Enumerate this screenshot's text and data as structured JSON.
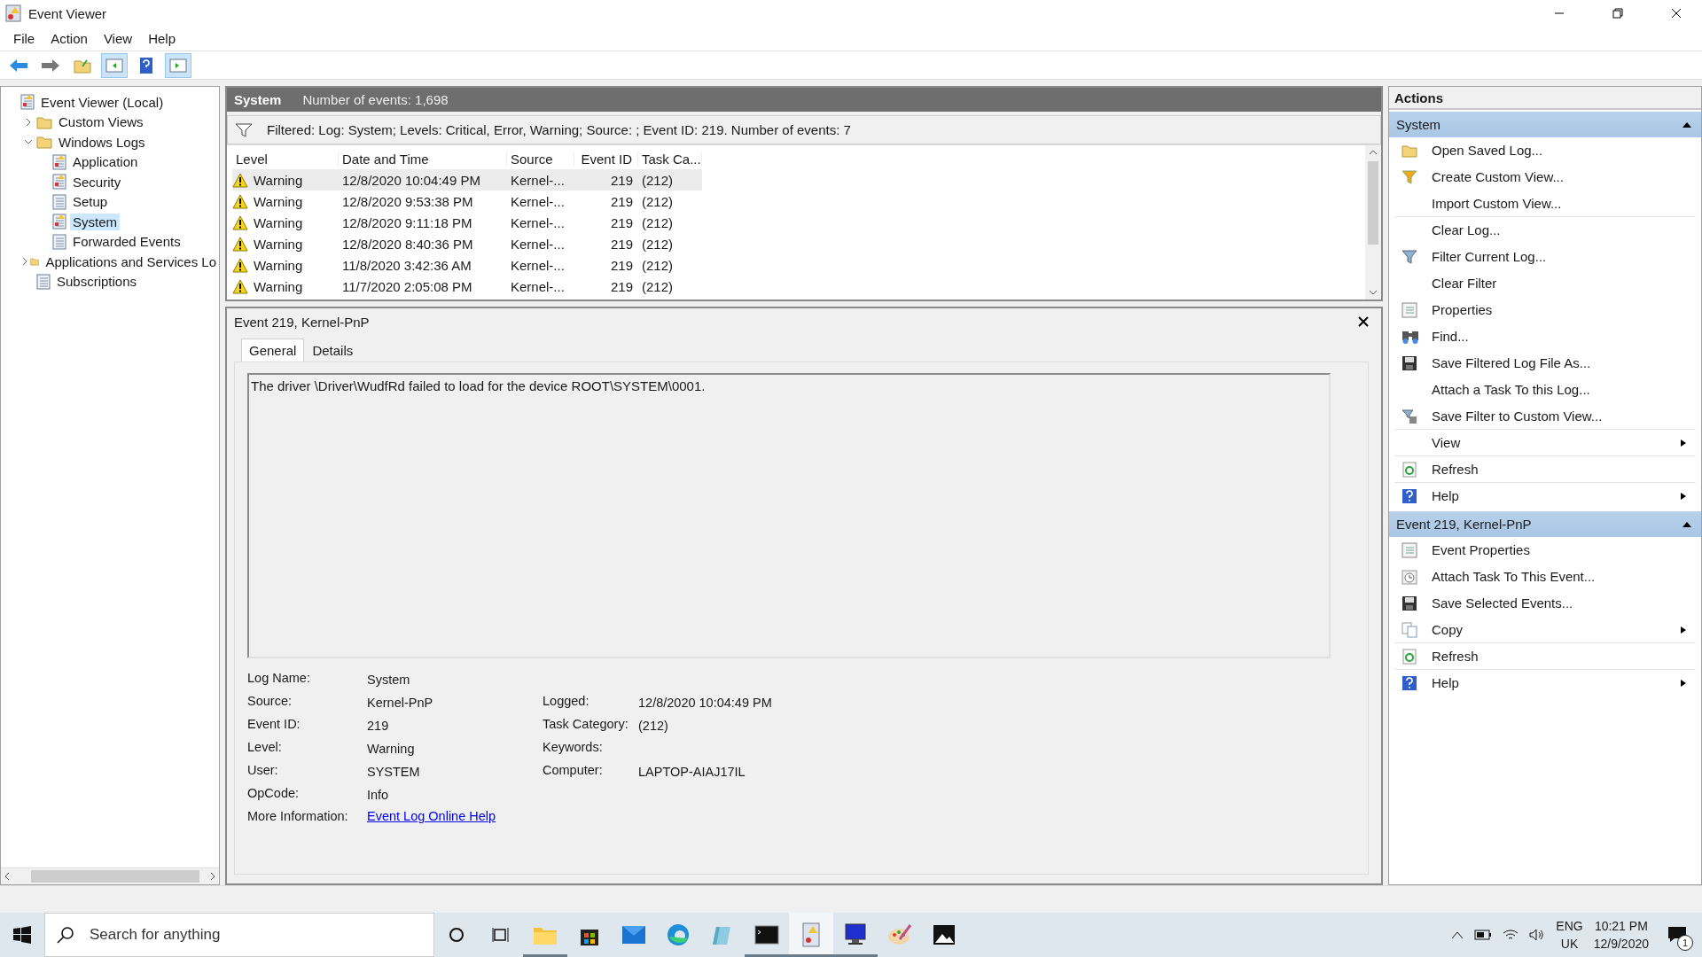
{
  "window": {
    "title": "Event Viewer"
  },
  "menu": [
    "File",
    "Action",
    "View",
    "Help"
  ],
  "tree": [
    {
      "label": "Event Viewer (Local)",
      "selected": false,
      "children": [
        {
          "label": "Custom Views",
          "expanded": false,
          "selected": false
        },
        {
          "label": "Windows Logs",
          "expanded": true,
          "selected": false,
          "children": [
            {
              "label": "Application",
              "selected": false
            },
            {
              "label": "Security",
              "selected": false
            },
            {
              "label": "Setup",
              "selected": false
            },
            {
              "label": "System",
              "selected": true
            },
            {
              "label": "Forwarded Events",
              "selected": false
            }
          ]
        },
        {
          "label": "Applications and Services Lo",
          "expanded": false,
          "selected": false
        },
        {
          "label": "Subscriptions",
          "selected": false
        }
      ]
    }
  ],
  "log_header": {
    "name": "System",
    "count": "Number of events: 1,698"
  },
  "filter": "Filtered: Log: System; Levels: Critical, Error, Warning; Source: ; Event ID: 219. Number of events: 7",
  "table": {
    "columns": [
      "Level",
      "Date and Time",
      "Source",
      "Event ID",
      "Task Ca..."
    ],
    "rows": [
      {
        "level": "Warning",
        "date": "12/8/2020 10:04:49 PM",
        "source": "Kernel-...",
        "event_id": "219",
        "task_category": "(212)",
        "selected": true
      },
      {
        "level": "Warning",
        "date": "12/8/2020 9:53:38 PM",
        "source": "Kernel-...",
        "event_id": "219",
        "task_category": "(212)",
        "selected": false
      },
      {
        "level": "Warning",
        "date": "12/8/2020 9:11:18 PM",
        "source": "Kernel-...",
        "event_id": "219",
        "task_category": "(212)",
        "selected": false
      },
      {
        "level": "Warning",
        "date": "12/8/2020 8:40:36 PM",
        "source": "Kernel-...",
        "event_id": "219",
        "task_category": "(212)",
        "selected": false
      },
      {
        "level": "Warning",
        "date": "11/8/2020 3:42:36 AM",
        "source": "Kernel-...",
        "event_id": "219",
        "task_category": "(212)",
        "selected": false
      },
      {
        "level": "Warning",
        "date": "11/7/2020 2:05:08 PM",
        "source": "Kernel-...",
        "event_id": "219",
        "task_category": "(212)",
        "selected": false
      }
    ]
  },
  "detail": {
    "title": "Event 219, Kernel-PnP",
    "tabs": [
      {
        "label": "General",
        "selected": true
      },
      {
        "label": "Details",
        "selected": false
      }
    ],
    "message": "The driver \\Driver\\WudfRd failed to load for the device ROOT\\SYSTEM\\0001.",
    "fields_left": [
      {
        "label": "Log Name:",
        "value": "System"
      },
      {
        "label": "Source:",
        "value": "Kernel-PnP"
      },
      {
        "label": "Event ID:",
        "value": "219"
      },
      {
        "label": "Level:",
        "value": "Warning"
      },
      {
        "label": "User:",
        "value": "SYSTEM"
      },
      {
        "label": "OpCode:",
        "value": "Info"
      }
    ],
    "fields_right": [
      {
        "label": "Logged:",
        "value": "12/8/2020 10:04:49 PM"
      },
      {
        "label": "Task Category:",
        "value": "(212)"
      },
      {
        "label": "Keywords:"
      },
      {
        "label": "Computer:",
        "value": "LAPTOP-AIAJ17IL"
      }
    ],
    "more_info": {
      "label": "More Information:",
      "link": "Event Log Online Help"
    }
  },
  "actions": {
    "title": "Actions",
    "groups": [
      {
        "title": "System",
        "expanded": true,
        "items": [
          {
            "label": "Open Saved Log...",
            "submenu": false,
            "divider": false
          },
          {
            "label": "Create Custom View...",
            "submenu": false,
            "divider": false
          },
          {
            "label": "Import Custom View...",
            "submenu": false,
            "divider": true
          },
          {
            "label": "Clear Log...",
            "submenu": false,
            "divider": false
          },
          {
            "label": "Filter Current Log...",
            "submenu": false,
            "divider": false
          },
          {
            "label": "Clear Filter",
            "submenu": false,
            "divider": false
          },
          {
            "label": "Properties",
            "submenu": false,
            "divider": false
          },
          {
            "label": "Find...",
            "submenu": false,
            "divider": false
          },
          {
            "label": "Save Filtered Log File As...",
            "submenu": false,
            "divider": false
          },
          {
            "label": "Attach a Task To this Log...",
            "submenu": false,
            "divider": false
          },
          {
            "label": "Save Filter to Custom View...",
            "submenu": false,
            "divider": true
          },
          {
            "label": "View",
            "submenu": true,
            "divider": true
          },
          {
            "label": "Refresh",
            "submenu": false,
            "divider": true
          },
          {
            "label": "Help",
            "submenu": true,
            "divider": false
          }
        ]
      },
      {
        "title": "Event 219, Kernel-PnP",
        "expanded": true,
        "items": [
          {
            "label": "Event Properties",
            "submenu": false,
            "divider": false
          },
          {
            "label": "Attach Task To This Event...",
            "submenu": false,
            "divider": false
          },
          {
            "label": "Save Selected Events...",
            "submenu": false,
            "divider": false
          },
          {
            "label": "Copy",
            "submenu": true,
            "divider": true
          },
          {
            "label": "Refresh",
            "submenu": false,
            "divider": true
          },
          {
            "label": "Help",
            "submenu": true,
            "divider": false
          }
        ]
      }
    ]
  },
  "taskbar": {
    "search_placeholder": "Search for anything",
    "apps": [
      {
        "running": true,
        "selected": false
      },
      {
        "running": false,
        "selected": false
      },
      {
        "running": false,
        "selected": false
      },
      {
        "running": false,
        "selected": false
      },
      {
        "running": false,
        "selected": false
      },
      {
        "running": true,
        "selected": false
      },
      {
        "running": true,
        "selected": true
      },
      {
        "running": true,
        "selected": false
      },
      {
        "running": false,
        "selected": false
      },
      {
        "running": false,
        "selected": false
      }
    ],
    "language": "ENG",
    "region": "UK",
    "time": "10:21 PM",
    "date": "12/9/2020",
    "notifications": "1"
  }
}
